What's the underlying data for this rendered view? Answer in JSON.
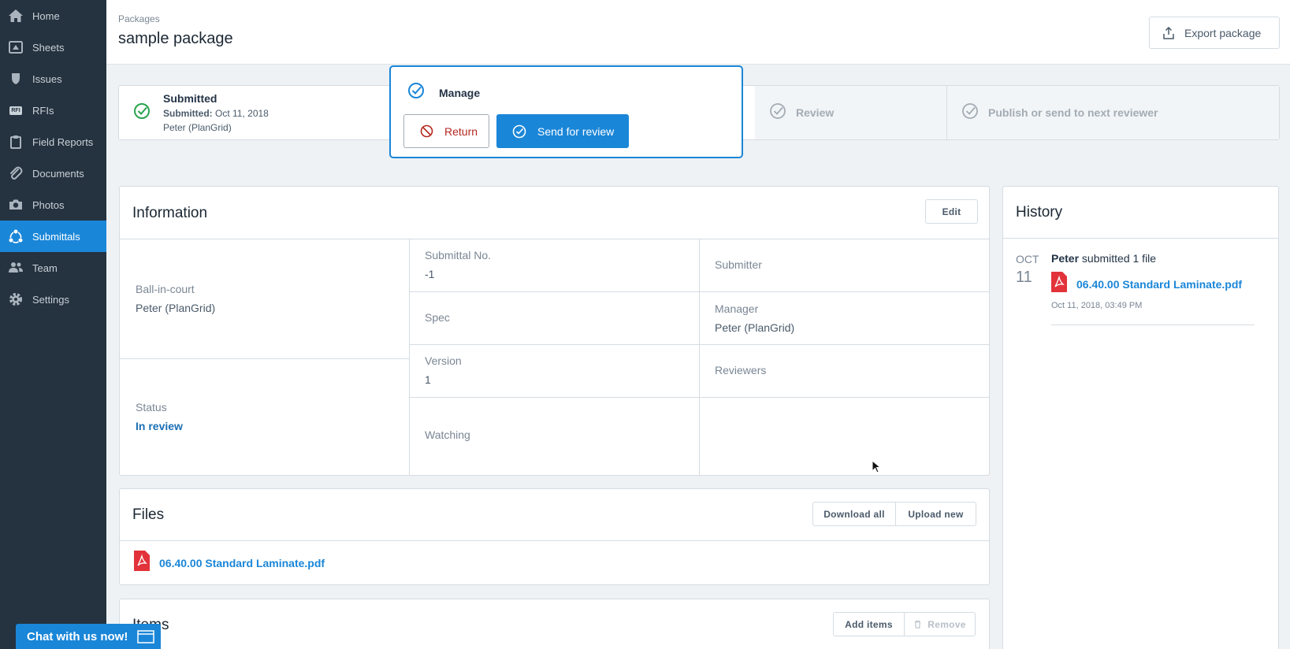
{
  "sidebar": {
    "items": [
      {
        "label": "Home",
        "icon": "home-icon"
      },
      {
        "label": "Sheets",
        "icon": "sheets-icon"
      },
      {
        "label": "Issues",
        "icon": "issues-icon"
      },
      {
        "label": "RFIs",
        "icon": "rfi-icon",
        "badge": "RFI"
      },
      {
        "label": "Field Reports",
        "icon": "clipboard-icon"
      },
      {
        "label": "Documents",
        "icon": "paperclip-icon"
      },
      {
        "label": "Photos",
        "icon": "camera-icon"
      },
      {
        "label": "Submittals",
        "icon": "submittals-icon",
        "active": true
      },
      {
        "label": "Team",
        "icon": "team-icon"
      },
      {
        "label": "Settings",
        "icon": "gear-icon"
      }
    ]
  },
  "header": {
    "breadcrumb": "Packages",
    "title": "sample package",
    "export_label": "Export package"
  },
  "workflow": {
    "submitted": {
      "title": "Submitted",
      "date_label": "Submitted:",
      "date": "Oct 11, 2018",
      "by": "Peter (PlanGrid)"
    },
    "review_label": "Review",
    "publish_label": "Publish or send to next reviewer"
  },
  "manage": {
    "title": "Manage",
    "return_label": "Return",
    "send_label": "Send for review"
  },
  "information": {
    "title": "Information",
    "edit_label": "Edit",
    "ball_in_court": {
      "label": "Ball-in-court",
      "value": "Peter (PlanGrid)"
    },
    "status": {
      "label": "Status",
      "value": "In review"
    },
    "submittal_no": {
      "label": "Submittal No.",
      "value": "-1"
    },
    "spec": {
      "label": "Spec"
    },
    "version": {
      "label": "Version",
      "value": "1"
    },
    "watching": {
      "label": "Watching"
    },
    "submitter": {
      "label": "Submitter"
    },
    "manager": {
      "label": "Manager",
      "value": "Peter (PlanGrid)"
    },
    "reviewers": {
      "label": "Reviewers"
    }
  },
  "files": {
    "title": "Files",
    "download_all_label": "Download all",
    "upload_new_label": "Upload new",
    "list": [
      {
        "name": "06.40.00 Standard Laminate.pdf"
      }
    ]
  },
  "items": {
    "title": "Items",
    "add_label": "Add items",
    "remove_label": "Remove"
  },
  "history": {
    "title": "History",
    "entries": [
      {
        "month": "OCT",
        "day": "11",
        "actor": "Peter",
        "action": "submitted 1 file",
        "file": "06.40.00 Standard Laminate.pdf",
        "time": "Oct 11, 2018, 03:49 PM"
      }
    ]
  },
  "chat": {
    "label": "Chat with us now!"
  },
  "colors": {
    "accent": "#1a86d8",
    "sidebar": "#25323f",
    "success": "#2aa44f",
    "danger": "#b4281e",
    "pdf": "#e2333a"
  }
}
